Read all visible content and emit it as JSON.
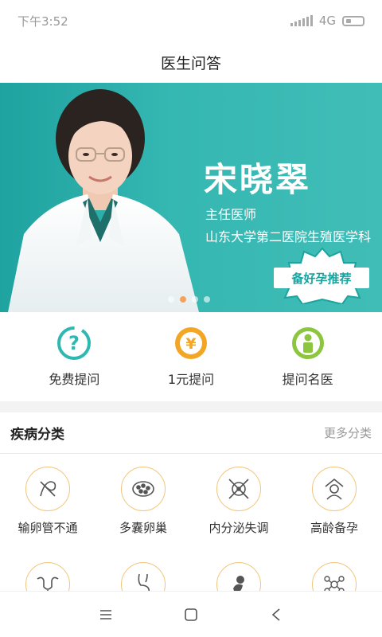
{
  "status_bar": {
    "time": "下午3:52",
    "network": "4G"
  },
  "header": {
    "title": "医生问答"
  },
  "banner": {
    "doctor_name": "宋晓翠",
    "doctor_title": "主任医师",
    "doctor_hospital": "山东大学第二医院生殖医学科",
    "badge": "备好孕推荐",
    "accent_color": "#2fb0ab"
  },
  "quick_actions": [
    {
      "label": "免费提问",
      "icon": "question-mark-icon",
      "color": "#2fb8b2"
    },
    {
      "label": "1元提问",
      "icon": "yen-coin-icon",
      "color": "#f2a623"
    },
    {
      "label": "提问名医",
      "icon": "doctor-icon",
      "color": "#8cc63f"
    }
  ],
  "category_section": {
    "title": "疾病分类",
    "more": "更多分类",
    "items": [
      {
        "label": "输卵管不通",
        "icon": "fallopian-tube-icon"
      },
      {
        "label": "多囊卵巢",
        "icon": "polycystic-ovary-icon"
      },
      {
        "label": "内分泌失调",
        "icon": "endocrine-icon"
      },
      {
        "label": "高龄备孕",
        "icon": "elderly-pregnancy-icon"
      },
      {
        "label": "",
        "icon": "uterus-icon"
      },
      {
        "label": "",
        "icon": "pregnant-body-icon"
      },
      {
        "label": "",
        "icon": "fetus-icon"
      },
      {
        "label": "",
        "icon": "cells-icon"
      }
    ]
  }
}
